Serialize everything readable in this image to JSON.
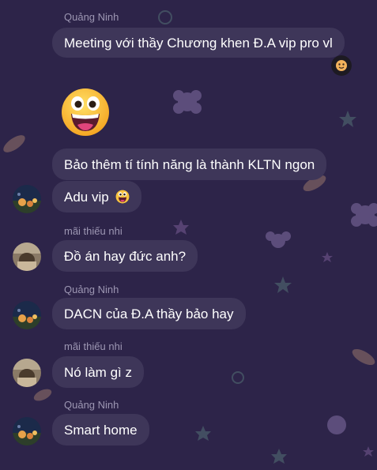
{
  "messages": [
    {
      "sender": "Quảng Ninh",
      "text": "Meeting với thầy Chương khen Đ.A vip pro vl"
    },
    {
      "text": "Bảo thêm tí tính năng là thành KLTN ngon"
    },
    {
      "text": "Adu vip"
    },
    {
      "sender": "mãi thiếu nhi",
      "text": "Đồ án hay đức anh?"
    },
    {
      "sender": "Quảng Ninh",
      "text": "DACN của Đ.A thầy bảo hay"
    },
    {
      "sender": "mãi thiếu nhi",
      "text": "Nó làm gì z"
    },
    {
      "sender": "Quảng Ninh",
      "text": "Smart home"
    }
  ],
  "colors": {
    "background": "#2d2449",
    "bubble": "#3e3659",
    "sender_text": "#9d97b3",
    "message_text": "#ffffff"
  },
  "icons": {
    "big_emoji": "grinning-face-icon",
    "inline_emoji": "grinning-face-icon",
    "seen_indicator": "seen-avatar-icon"
  }
}
